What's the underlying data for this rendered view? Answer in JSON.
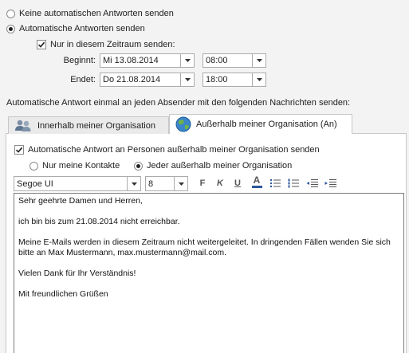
{
  "reply_mode": {
    "option_off": "Keine automatischen Antworten senden",
    "option_on": "Automatische Antworten senden",
    "selected": "on"
  },
  "time_range": {
    "checkbox_label": "Nur in diesem Zeitraum senden:",
    "checked": true,
    "start_label": "Beginnt:",
    "start_date": "Mi 13.08.2014",
    "start_time": "08:00",
    "end_label": "Endet:",
    "end_date": "Do 21.08.2014",
    "end_time": "18:00"
  },
  "instruction": "Automatische Antwort einmal an jeden Absender mit den folgenden Nachrichten senden:",
  "tabs": [
    {
      "label": "Innerhalb meiner Organisation",
      "active": false
    },
    {
      "label": "Außerhalb meiner Organisation (An)",
      "active": true
    }
  ],
  "outside": {
    "checkbox_label": "Automatische Antwort an Personen außerhalb meiner Organisation senden",
    "checked": true,
    "radio_contacts": "Nur meine Kontakte",
    "radio_everyone": "Jeder außerhalb meiner Organisation",
    "selected": "everyone"
  },
  "toolbar": {
    "font": "Segoe UI",
    "size": "8",
    "bold": "F",
    "italic": "K",
    "underline": "U",
    "font_color": "A"
  },
  "message": {
    "line1": "Sehr geehrte Damen und Herren,",
    "line2": "ich bin bis zum 21.08.2014 nicht erreichbar.",
    "line3": "Meine E-Mails werden in diesem Zeitraum nicht weitergeleitet. In dringenden Fällen wenden Sie sich bitte an Max Mustermann, max.mustermann@mail.com.",
    "line4": "Vielen Dank für Ihr Verständnis!",
    "line5": "Mit freundlichen Grüßen"
  },
  "colors": {
    "accent_underline": "#2b579a",
    "check_mark": "#1e1e1e"
  }
}
